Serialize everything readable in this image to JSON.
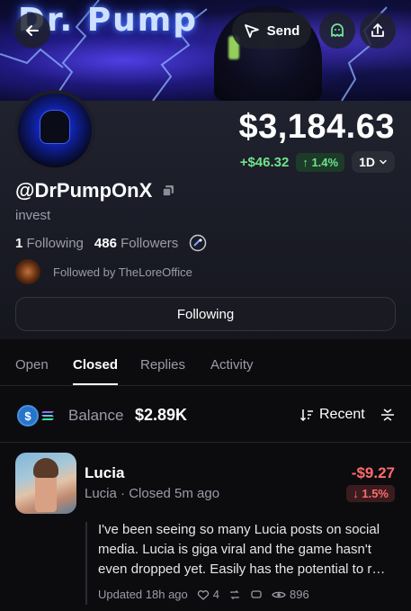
{
  "banner": {
    "title": "Dr. Pump"
  },
  "header": {
    "send_label": "Send"
  },
  "profile": {
    "price": "$3,184.63",
    "change_abs": "+$46.32",
    "change_pct": "↑ 1.4%",
    "range": "1D",
    "username": "@DrPumpOnX",
    "bio": "invest",
    "following_count": "1",
    "following_label": "Following",
    "followers_count": "486",
    "followers_label": "Followers",
    "followed_by": "Followed by TheLoreOffice",
    "follow_button": "Following"
  },
  "tabs": [
    "Open",
    "Closed",
    "Replies",
    "Activity"
  ],
  "active_tab": "Closed",
  "balance": {
    "label": "Balance",
    "value": "$2.89K",
    "sort_label": "Recent"
  },
  "post": {
    "title": "Lucia",
    "subtitle": "Lucia · Closed 5m ago",
    "pnl": "-$9.27",
    "pnl_pct": "↓ 1.5%",
    "text": "I've been seeing so many Lucia posts on social media. Lucia is giga viral and the game hasn't even dropped yet. Easily has the potential to r…",
    "updated": "Updated 18h ago",
    "likes": "4",
    "views": "896"
  },
  "colors": {
    "positive": "#6fe38a",
    "negative": "#ff6b6b",
    "background": "#0c0c0f"
  }
}
